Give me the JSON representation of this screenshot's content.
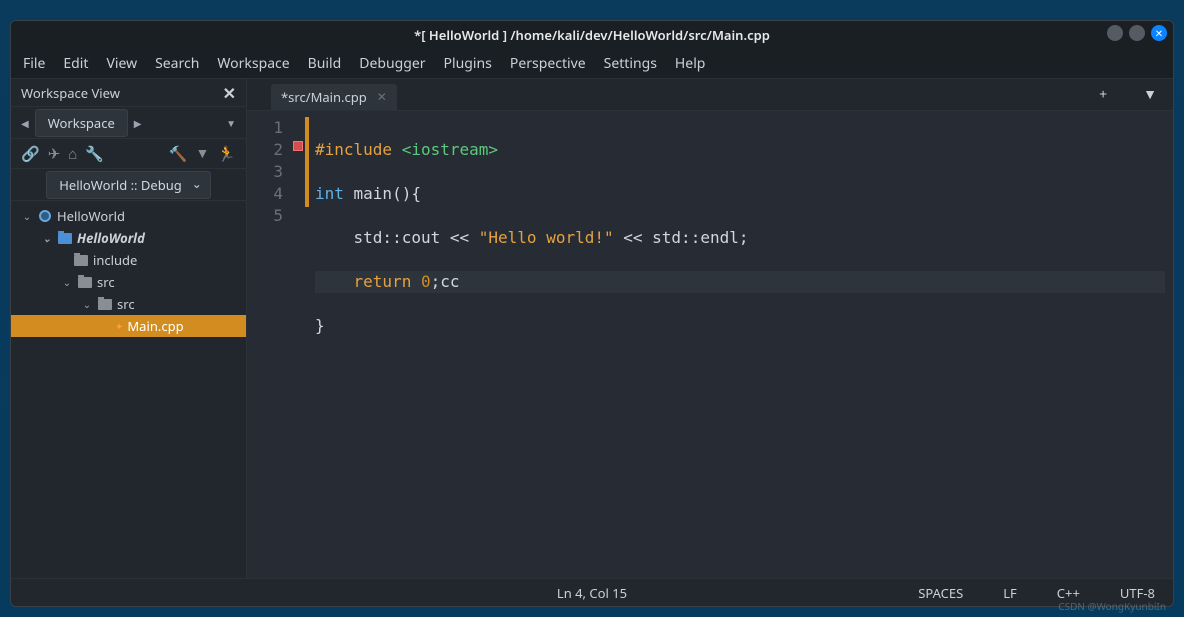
{
  "window": {
    "title": "*[ HelloWorld ] /home/kali/dev/HelloWorld/src/Main.cpp"
  },
  "menubar": [
    "File",
    "Edit",
    "View",
    "Search",
    "Workspace",
    "Build",
    "Debugger",
    "Plugins",
    "Perspective",
    "Settings",
    "Help"
  ],
  "sidebar": {
    "header": "Workspace View",
    "workspace_btn": "Workspace",
    "config": "HelloWorld :: Debug",
    "tree": {
      "root": "HelloWorld",
      "project": "HelloWorld",
      "include": "include",
      "src1": "src",
      "src2": "src",
      "file": "Main.cpp"
    }
  },
  "tabs": {
    "active": "*src/Main.cpp"
  },
  "code": {
    "l1_inc": "#include ",
    "l1_hdr": "<iostream>",
    "l2_type": "int ",
    "l2_fn": "main",
    "l2_rest": "(){",
    "l3_pre": "    std::cout << ",
    "l3_str": "\"Hello world!\"",
    "l3_post": " << std::endl;",
    "l4_pre": "    ",
    "l4_kw": "return ",
    "l4_num": "0",
    "l4_post": ";cc",
    "l5": "}"
  },
  "gutter": [
    "1",
    "2",
    "3",
    "4",
    "5"
  ],
  "status": {
    "pos": "Ln 4, Col 15",
    "indent": "SPACES",
    "eol": "LF",
    "lang": "C++",
    "enc": "UTF-8"
  },
  "watermark": "CSDN @WongKyunbiIn"
}
